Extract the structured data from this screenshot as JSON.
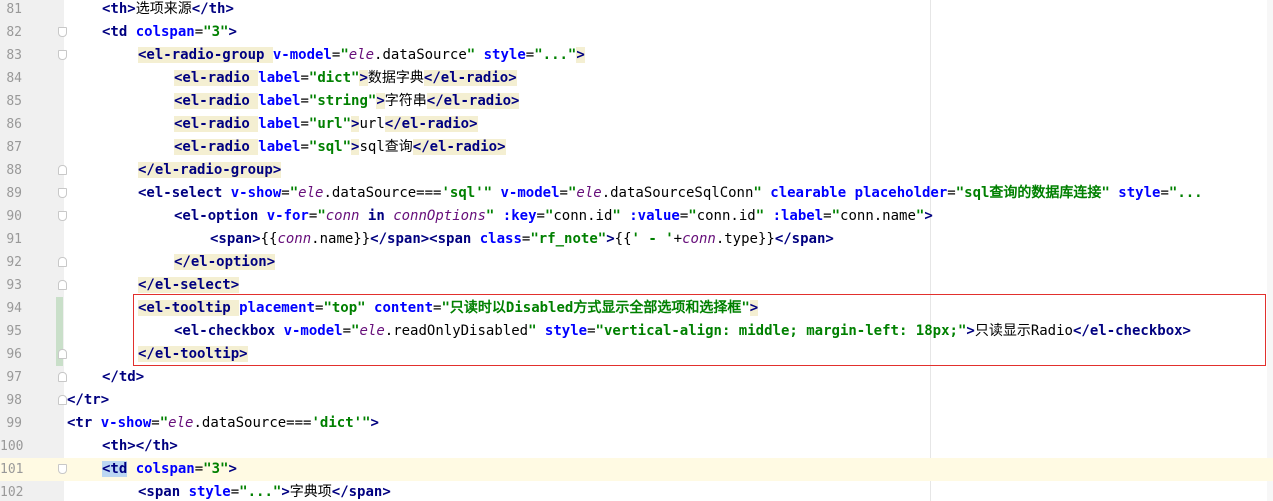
{
  "editor": {
    "language": "html",
    "current_line": "101",
    "highlight_box_color": "#e2302d",
    "lines": [
      {
        "no": "81",
        "segs": [
          [
            "tag",
            "<th"
          ],
          [
            "tag",
            ">"
          ],
          [
            "txt",
            "选项来源"
          ],
          [
            "tag",
            "</th>"
          ]
        ]
      },
      {
        "no": "82",
        "segs": [
          [
            "tag",
            "<td "
          ],
          [
            "attr",
            "colspan"
          ],
          [
            "txt",
            "="
          ],
          [
            "str",
            "\"3\""
          ],
          [
            "tag",
            ">"
          ]
        ]
      },
      {
        "no": "83",
        "segs": [
          [
            "tag",
            "<el-radio-group "
          ],
          [
            "attr",
            "v-model"
          ],
          [
            "txt",
            "="
          ],
          [
            "str",
            "\""
          ],
          [
            "var",
            "ele"
          ],
          [
            "txt",
            ".dataSource"
          ],
          [
            "str",
            "\" "
          ],
          [
            "attr",
            "style"
          ],
          [
            "txt",
            "="
          ],
          [
            "str",
            "\"...\""
          ],
          [
            "tag",
            ">"
          ]
        ]
      },
      {
        "no": "84",
        "segs": [
          [
            "tag",
            "<el-radio "
          ],
          [
            "attr",
            "label"
          ],
          [
            "txt",
            "="
          ],
          [
            "str",
            "\"dict\""
          ],
          [
            "tag",
            ">"
          ],
          [
            "txt",
            "数据字典"
          ],
          [
            "tag",
            "</el-radio>"
          ]
        ]
      },
      {
        "no": "85",
        "segs": [
          [
            "tag",
            "<el-radio "
          ],
          [
            "attr",
            "label"
          ],
          [
            "txt",
            "="
          ],
          [
            "str",
            "\"string\""
          ],
          [
            "tag",
            ">"
          ],
          [
            "txt",
            "字符串"
          ],
          [
            "tag",
            "</el-radio>"
          ]
        ]
      },
      {
        "no": "86",
        "segs": [
          [
            "tag",
            "<el-radio "
          ],
          [
            "attr",
            "label"
          ],
          [
            "txt",
            "="
          ],
          [
            "str",
            "\"url\""
          ],
          [
            "tag",
            ">"
          ],
          [
            "txt",
            "url"
          ],
          [
            "tag",
            "</el-radio>"
          ]
        ]
      },
      {
        "no": "87",
        "segs": [
          [
            "tag",
            "<el-radio "
          ],
          [
            "attr",
            "label"
          ],
          [
            "txt",
            "="
          ],
          [
            "str",
            "\"sql\""
          ],
          [
            "tag",
            ">"
          ],
          [
            "txt",
            "sql查询"
          ],
          [
            "tag",
            "</el-radio>"
          ]
        ]
      },
      {
        "no": "88",
        "segs": [
          [
            "tag",
            "</el-radio-group>"
          ]
        ]
      },
      {
        "no": "89",
        "segs": [
          [
            "tag",
            "<el-select "
          ],
          [
            "attr",
            "v-show"
          ],
          [
            "txt",
            "="
          ],
          [
            "str",
            "\""
          ],
          [
            "var",
            "ele"
          ],
          [
            "txt",
            ".dataSource==="
          ],
          [
            "str",
            "'sql'\" "
          ],
          [
            "attr",
            "v-model"
          ],
          [
            "txt",
            "="
          ],
          [
            "str",
            "\""
          ],
          [
            "var",
            "ele"
          ],
          [
            "txt",
            ".dataSourceSqlConn"
          ],
          [
            "str",
            "\" "
          ],
          [
            "attr",
            "clearable "
          ],
          [
            "attr",
            "placeholder"
          ],
          [
            "txt",
            "="
          ],
          [
            "str",
            "\"sql查询的数据库连接\" "
          ],
          [
            "attr",
            "style"
          ],
          [
            "txt",
            "="
          ],
          [
            "str",
            "\"..."
          ]
        ]
      },
      {
        "no": "90",
        "segs": [
          [
            "tag",
            "<el-option "
          ],
          [
            "attr",
            "v-for"
          ],
          [
            "txt",
            "="
          ],
          [
            "str",
            "\""
          ],
          [
            "var",
            "conn "
          ],
          [
            "kw",
            "in "
          ],
          [
            "var",
            "connOptions"
          ],
          [
            "str",
            "\" "
          ],
          [
            "attr",
            ":key"
          ],
          [
            "txt",
            "="
          ],
          [
            "str",
            "\""
          ],
          [
            "txt",
            "conn.id"
          ],
          [
            "str",
            "\" "
          ],
          [
            "attr",
            ":value"
          ],
          [
            "txt",
            "="
          ],
          [
            "str",
            "\""
          ],
          [
            "txt",
            "conn.id"
          ],
          [
            "str",
            "\" "
          ],
          [
            "attr",
            ":label"
          ],
          [
            "txt",
            "="
          ],
          [
            "str",
            "\""
          ],
          [
            "txt",
            "conn.name"
          ],
          [
            "str",
            "\""
          ],
          [
            "tag",
            ">"
          ]
        ]
      },
      {
        "no": "91",
        "segs": [
          [
            "tag",
            "<span>"
          ],
          [
            "txt",
            "{{"
          ],
          [
            "var",
            "conn"
          ],
          [
            "txt",
            ".name}}"
          ],
          [
            "tag",
            "</span><span "
          ],
          [
            "attr",
            "class"
          ],
          [
            "txt",
            "="
          ],
          [
            "str",
            "\"rf_note\""
          ],
          [
            "tag",
            ">"
          ],
          [
            "txt",
            "{{"
          ],
          [
            "str",
            "' - '"
          ],
          [
            "txt",
            "+"
          ],
          [
            "var",
            "conn"
          ],
          [
            "txt",
            ".type}}"
          ],
          [
            "tag",
            "</span>"
          ]
        ]
      },
      {
        "no": "92",
        "segs": [
          [
            "tag",
            "</el-option>"
          ]
        ]
      },
      {
        "no": "93",
        "segs": [
          [
            "tag",
            "</el-select>"
          ]
        ]
      },
      {
        "no": "94",
        "segs": [
          [
            "tag",
            "<el-tooltip "
          ],
          [
            "attr",
            "placement"
          ],
          [
            "txt",
            "="
          ],
          [
            "str",
            "\"top\" "
          ],
          [
            "attr",
            "content"
          ],
          [
            "txt",
            "="
          ],
          [
            "str",
            "\"只读时以Disabled方式显示全部选项和选择框\""
          ],
          [
            "tag",
            ">"
          ]
        ]
      },
      {
        "no": "95",
        "segs": [
          [
            "tag",
            "<el-checkbox "
          ],
          [
            "attr",
            "v-model"
          ],
          [
            "txt",
            "="
          ],
          [
            "str",
            "\""
          ],
          [
            "var",
            "ele"
          ],
          [
            "txt",
            ".readOnlyDisabled"
          ],
          [
            "str",
            "\" "
          ],
          [
            "attr",
            "style"
          ],
          [
            "txt",
            "="
          ],
          [
            "str",
            "\"vertical-align: middle; margin-left: 18px;\""
          ],
          [
            "tag",
            ">"
          ],
          [
            "txt",
            "只读显示Radio"
          ],
          [
            "tag",
            "</el-checkbox>"
          ]
        ]
      },
      {
        "no": "96",
        "segs": [
          [
            "tag",
            "</el-tooltip>"
          ]
        ]
      },
      {
        "no": "97",
        "segs": [
          [
            "tag",
            "</td>"
          ]
        ]
      },
      {
        "no": "98",
        "segs": [
          [
            "tag",
            "</tr>"
          ]
        ]
      },
      {
        "no": "99",
        "segs": [
          [
            "tag",
            "<tr "
          ],
          [
            "attr",
            "v-show"
          ],
          [
            "txt",
            "="
          ],
          [
            "str",
            "\""
          ],
          [
            "var",
            "ele"
          ],
          [
            "txt",
            ".dataSource==="
          ],
          [
            "str",
            "'dict'\""
          ],
          [
            "tag",
            ">"
          ]
        ]
      },
      {
        "no": "100",
        "segs": [
          [
            "tag",
            "<th></th>"
          ]
        ]
      },
      {
        "no": "101",
        "segs": [
          [
            "tag",
            "<td"
          ],
          [
            "attr",
            " colspan"
          ],
          [
            "txt",
            "="
          ],
          [
            "str",
            "\"3\""
          ],
          [
            "tag",
            ">"
          ]
        ]
      },
      {
        "no": "102",
        "segs": [
          [
            "tag",
            "<span "
          ],
          [
            "attr",
            "style"
          ],
          [
            "txt",
            "="
          ],
          [
            "str",
            "\"...\""
          ],
          [
            "tag",
            ">"
          ],
          [
            "txt",
            "字典项"
          ],
          [
            "tag",
            "</span>"
          ]
        ]
      }
    ]
  }
}
